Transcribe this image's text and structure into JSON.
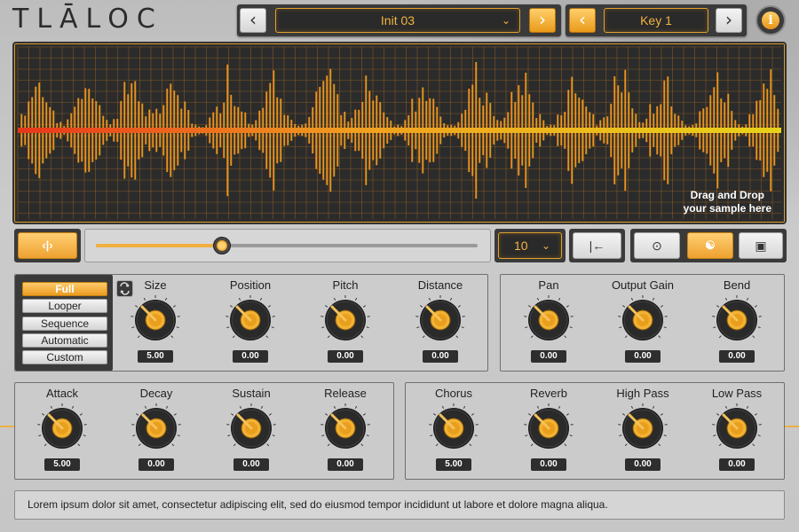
{
  "app": {
    "title": "TLĀLOC"
  },
  "header": {
    "preset_prev_icon": "chevron-left-icon",
    "preset_name": "Init 03",
    "preset_dropdown_icon": "chevron-down-icon",
    "preset_next_icon": "chevron-right-icon",
    "key_prev_icon": "chevron-left-icon",
    "key_name": "Key 1",
    "key_next_icon": "chevron-right-icon",
    "info_label": "i"
  },
  "waveform": {
    "drop_line1": "Drag and Drop",
    "drop_line2": "your sample here",
    "color_start": "#e8361c",
    "color_mid": "#f0a020",
    "color_end": "#e8d21a",
    "grid_color": "#c97c1e"
  },
  "transport": {
    "stretch_icon": "stretch-arrows-icon",
    "position": 0.33,
    "divisions_value": "10",
    "return_start_icon": "skip-to-start-icon",
    "center_icon": "crosshair-icon",
    "share_icon": "share-nodes-icon",
    "save_icon": "save-icon"
  },
  "modes": {
    "items": [
      "Full",
      "Looper",
      "Sequence",
      "Automatic",
      "Custom"
    ],
    "active": "Full",
    "loop_icon": "loop-icon"
  },
  "knobs": {
    "top_left": [
      {
        "label": "Size",
        "value": "5.00"
      },
      {
        "label": "Position",
        "value": "0.00"
      },
      {
        "label": "Pitch",
        "value": "0.00"
      },
      {
        "label": "Distance",
        "value": "0.00"
      }
    ],
    "top_right": [
      {
        "label": "Pan",
        "value": "0.00"
      },
      {
        "label": "Output Gain",
        "value": "0.00"
      },
      {
        "label": "Bend",
        "value": "0.00"
      }
    ],
    "bottom_left": [
      {
        "label": "Attack",
        "value": "5.00"
      },
      {
        "label": "Decay",
        "value": "0.00"
      },
      {
        "label": "Sustain",
        "value": "0.00"
      },
      {
        "label": "Release",
        "value": "0.00"
      }
    ],
    "bottom_right": [
      {
        "label": "Chorus",
        "value": "5.00"
      },
      {
        "label": "Reverb",
        "value": "0.00"
      },
      {
        "label": "High Pass",
        "value": "0.00"
      },
      {
        "label": "Low Pass",
        "value": "0.00"
      }
    ]
  },
  "footer": {
    "text": "Lorem ipsum dolor sit amet, consectetur adipiscing elit, sed do eiusmod tempor incididunt ut labore et dolore magna aliqua."
  },
  "colors": {
    "accent": "#f0b040",
    "panel_dark": "#3a3a3a"
  }
}
